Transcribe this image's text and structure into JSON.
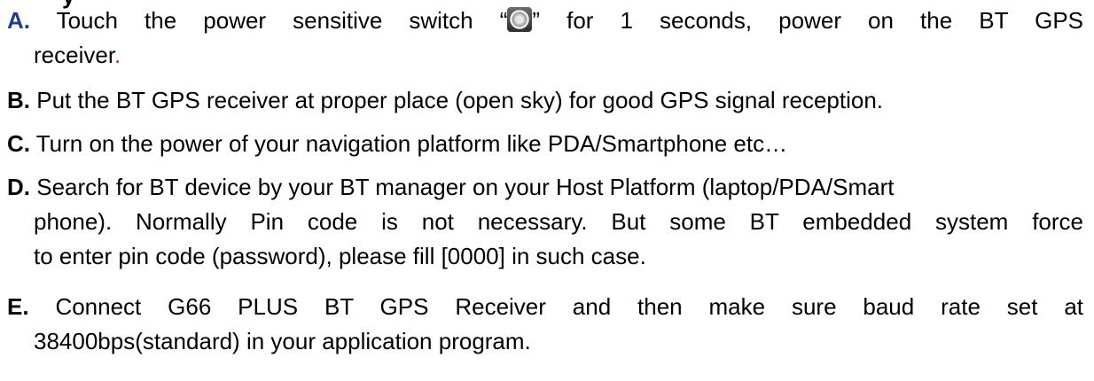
{
  "heading_fragment": "y",
  "steps": [
    {
      "letter": "A.",
      "line1_before": " Touch the power sensitive switch “",
      "icon": "power-switch-icon",
      "line1_after": "” for 1 seconds, power on the BT GPS",
      "line2_text": "receiver",
      "line2_end": "."
    },
    {
      "letter": "B.",
      "text": " Put the BT GPS receiver at proper place (open sky) for good GPS signal reception."
    },
    {
      "letter": "C.",
      "text": " Turn on the power of your navigation platform like PDA/Smartphone etc…"
    },
    {
      "letter": "D.",
      "line1": " Search for BT device by your BT manager on your Host Platform (laptop/PDA/Smart",
      "line2": "phone). Normally Pin code is not necessary. But some BT embedded system force",
      "line3": "to enter pin code (password), please fill [0000] in such case."
    },
    {
      "letter": "E.",
      "line1": " Connect G66 PLUS BT GPS Receiver and then make sure baud rate set at",
      "line2": "38400bps(standard) in your application program."
    }
  ],
  "colors": {
    "letter_a": "#1f3d8c",
    "accent_red": "#d01f1f",
    "text": "#000000"
  }
}
